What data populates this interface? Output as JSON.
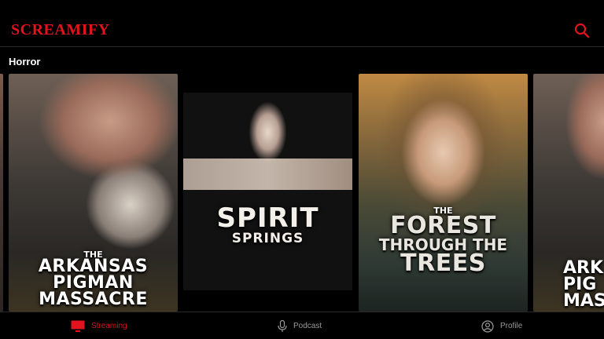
{
  "app": {
    "brand": "SCREAMIFY"
  },
  "header": {
    "search_icon": "search-icon",
    "accent": "#e0131f"
  },
  "section": {
    "title": "Horror"
  },
  "posters": [
    {
      "lines": [
        "THE",
        "ARKANSAS",
        "PIGMAN",
        "MASSACRE"
      ]
    },
    {
      "lines": [
        "SPIRIT",
        "SPRINGS"
      ]
    },
    {
      "lines": [
        "THE",
        "FOREST",
        "THROUGH THE",
        "TREES"
      ]
    },
    {
      "lines": [
        "ARK",
        "PIG",
        "MAS"
      ]
    }
  ],
  "nav": {
    "items": [
      {
        "label": "Streaming",
        "icon": "tv-icon",
        "active": true
      },
      {
        "label": "Podcast",
        "icon": "microphone-icon",
        "active": false
      },
      {
        "label": "Profile",
        "icon": "user-circle-icon",
        "active": false
      }
    ]
  }
}
